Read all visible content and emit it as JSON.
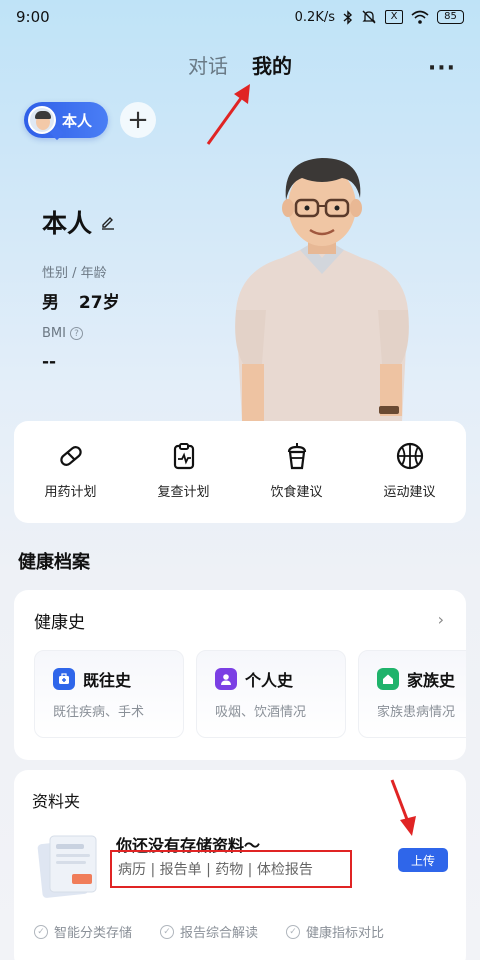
{
  "status_bar": {
    "time": "9:00",
    "speed": "0.2K/s",
    "bluetooth_icon": "bluetooth-icon",
    "mute_icon": "mute-icon",
    "x_badge": "X",
    "wifi_icon": "wifi-icon",
    "battery": "85"
  },
  "tabs": [
    {
      "label": "对话",
      "active": false
    },
    {
      "label": "我的",
      "active": true
    }
  ],
  "header": {
    "more_label": "···"
  },
  "profile": {
    "chip_label": "本人",
    "add_label": "+",
    "name": "本人",
    "gender_age_label": "性别 / 年龄",
    "gender": "男",
    "age": "27岁",
    "bmi_label": "BMI",
    "bmi_help": "?",
    "bmi_value": "--"
  },
  "quick_actions": [
    {
      "label": "用药计划",
      "icon": "pill-icon"
    },
    {
      "label": "复查计划",
      "icon": "clipboard-pulse-icon"
    },
    {
      "label": "饮食建议",
      "icon": "drink-cup-icon"
    },
    {
      "label": "运动建议",
      "icon": "basketball-icon"
    }
  ],
  "health_records": {
    "section_title": "健康档案",
    "history_title": "健康史",
    "chevron": "›",
    "cards": [
      {
        "title": "既往史",
        "subtitle": "既往疾病、手术",
        "icon": "medical-kit-icon",
        "color": "#2f66ea"
      },
      {
        "title": "个人史",
        "subtitle": "吸烟、饮酒情况",
        "icon": "person-icon",
        "color": "#7b3fe4"
      },
      {
        "title": "家族史",
        "subtitle": "家族患病情况",
        "icon": "home-icon",
        "color": "#1fb36b"
      }
    ]
  },
  "folder": {
    "title": "资料夹",
    "empty_title": "你还没有存储资料～",
    "tags": "病历 | 报告单 | 药物 | 体检报告",
    "upload_label": "上传",
    "features": [
      {
        "label": "智能分类存储"
      },
      {
        "label": "报告综合解读"
      },
      {
        "label": "健康指标对比"
      }
    ]
  },
  "colors": {
    "accent": "#2f66ea",
    "annotation_red": "#e02424"
  }
}
